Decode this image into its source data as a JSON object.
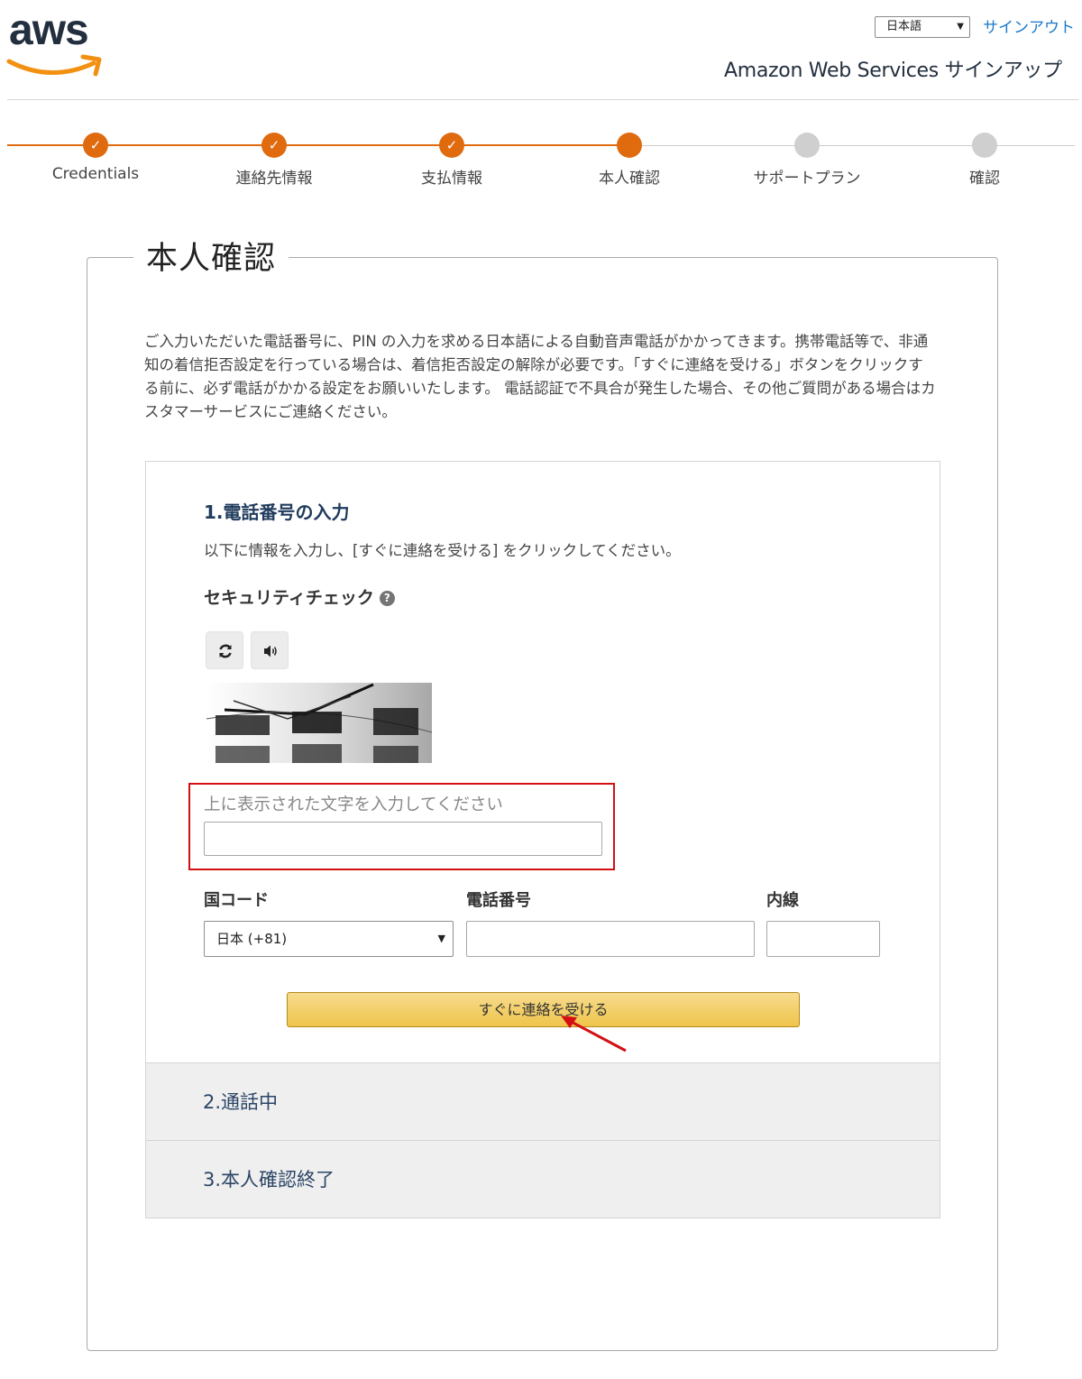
{
  "header": {
    "logo_text": "aws",
    "language": "日本語",
    "signout_label": "サインアウト",
    "title": "Amazon Web Services サインアップ"
  },
  "progress": {
    "steps": [
      {
        "label": "Credentials",
        "status": "done"
      },
      {
        "label": "連絡先情報",
        "status": "done"
      },
      {
        "label": "支払情報",
        "status": "done"
      },
      {
        "label": "本人確認",
        "status": "current"
      },
      {
        "label": "サポートプラン",
        "status": "todo"
      },
      {
        "label": "確認",
        "status": "todo"
      }
    ],
    "check_glyph": "✓"
  },
  "panel": {
    "title": "本人確認",
    "intro": "ご入力いただいた電話番号に、PIN の入力を求める日本語による自動音声電話がかかってきます。携帯電話等で、非通知の着信拒否設定を行っている場合は、着信拒否設定の解除が必要です。「すぐに連絡を受ける」ボタンをクリックする前に、必ず電話がかかる設定をお願いいたします。 電話認証で不具合が発生した場合、その他ご質問がある場合はカスタマーサービスにご連絡ください。"
  },
  "step1": {
    "title": "1.電話番号の入力",
    "description": "以下に情報を入力し、[すぐに連絡を受ける] をクリックしてください。",
    "security_check_label": "セキュリティチェック",
    "help_glyph": "?",
    "captcha_label": "上に表示された文字を入力してください",
    "captcha_value": "",
    "country_code_label": "国コード",
    "country_code_value": "日本 (+81)",
    "phone_label": "電話番号",
    "phone_value": "",
    "extension_label": "内線",
    "extension_value": "",
    "call_button_label": "すぐに連絡を受ける"
  },
  "step2": {
    "title": "2.通話中"
  },
  "step3": {
    "title": "3.本人確認終了"
  },
  "colors": {
    "accent_orange": "#e06a0e",
    "link_blue": "#1a79c9",
    "highlight_red": "#d40f14",
    "button_yellow": "#f0c14b"
  }
}
